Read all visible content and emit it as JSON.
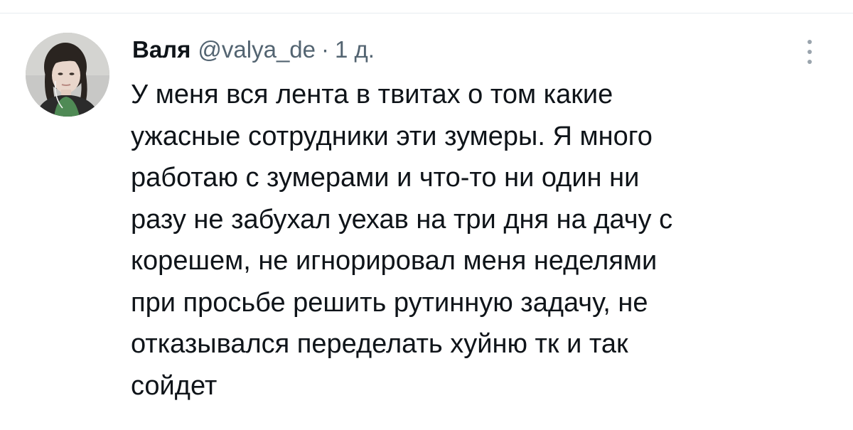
{
  "tweet": {
    "author": {
      "display_name": "Валя",
      "handle": "@valya_de",
      "separator": "·",
      "timestamp": "1 д.",
      "avatar_icon": "user-photo-avatar"
    },
    "text": "У меня вся лента в твитах о том какие\nужасные сотрудники эти зумеры. Я много\nработаю с зумерами и что-то ни один ни\nразу не забухал уехав на три дня на дачу с\nкорешем, не игнорировал меня неделями\nпри просьбе решить рутинную задачу, не\nотказывался переделать хуйню тк и так\nсойдет",
    "more_icon": "more-vertical-icon"
  },
  "colors": {
    "text_primary": "#0f1419",
    "text_secondary": "#536471",
    "divider": "#e6ecf0",
    "background": "#ffffff"
  }
}
